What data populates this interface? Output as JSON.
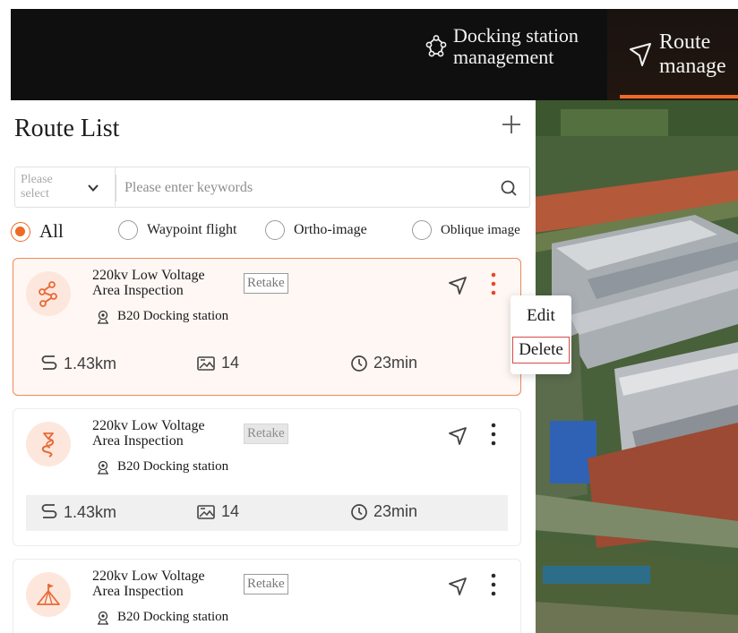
{
  "nav": {
    "docking": {
      "label_line1": "Docking station",
      "label_line2": "management",
      "icon": "docking-station-icon"
    },
    "route": {
      "label_line1": "Route",
      "label_line2": "manage",
      "icon": "route-navigation-icon"
    }
  },
  "panel": {
    "title": "Route List",
    "add_icon": "plus-icon"
  },
  "filter": {
    "select_placeholder_line1": "Please",
    "select_placeholder_line2": "select",
    "search_placeholder": "Please enter keywords",
    "search_value": ""
  },
  "radios": [
    {
      "label": "All",
      "selected": true
    },
    {
      "label": "Waypoint flight",
      "selected": false
    },
    {
      "label": "Ortho-image",
      "selected": false
    },
    {
      "label": "Oblique image",
      "selected": false
    }
  ],
  "cards": [
    {
      "title_line1": "220kv Low Voltage",
      "title_line2": "Area Inspection",
      "badge": "Retake",
      "station": "B20 Docking station",
      "distance": "1.43km",
      "photos": "14",
      "duration": "23min",
      "selected": true,
      "icon": "waypoint-route-icon"
    },
    {
      "title_line1": "220kv Low Voltage",
      "title_line2": "Area Inspection",
      "badge": "Retake",
      "station": "B20 Docking station",
      "distance": "1.43km",
      "photos": "14",
      "duration": "23min",
      "selected": false,
      "icon": "ortho-route-icon"
    },
    {
      "title_line1": "220kv Low Voltage",
      "title_line2": "Area Inspection",
      "badge": "Retake",
      "station": "B20 Docking station",
      "distance": "",
      "photos": "",
      "duration": "",
      "selected": false,
      "icon": "oblique-route-icon"
    }
  ],
  "menu": {
    "edit": "Edit",
    "delete": "Delete"
  },
  "colors": {
    "accent": "#ee6a26",
    "nav_bg": "#0f0f0f",
    "selected_card_bg": "#fff7f3",
    "delete_outline": "#d64a4a"
  }
}
